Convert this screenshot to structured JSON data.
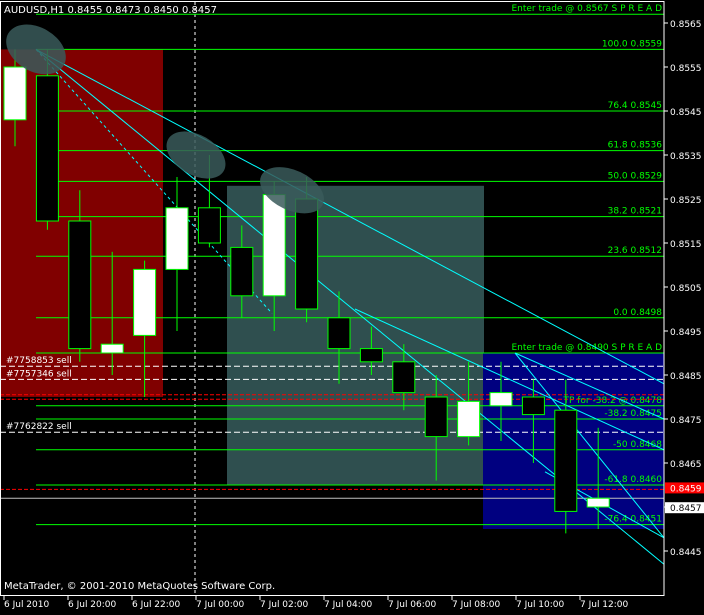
{
  "header": {
    "symbol_text": "AUDUSD,H1  0.8455 0.8473 0.8450 0.8457"
  },
  "footer": {
    "copyright": "MetaTrader, © 2001-2010 MetaQuotes Software Corp."
  },
  "colors": {
    "background": "#000000",
    "bull_candle": "#ffffff",
    "bear_candle": "#000000",
    "candle_outline": "#00ff00",
    "fib_line": "#00ff00",
    "fib_text": "#00ff00",
    "trend_line": "#00ffff",
    "zone_red": "#800000",
    "zone_teal": "#2f4f4f",
    "zone_blue": "#000080",
    "ellipse": "#3a5a5a",
    "current_price_bg": "#ffffff",
    "alert_price_bg": "#ff0000",
    "order_line": "#ffffff",
    "axis_text": "#ffffff"
  },
  "chart_data": {
    "type": "candlestick",
    "timeframe": "H1",
    "y_range": [
      0.844,
      0.857
    ],
    "price_axis_ticks": [
      "0.8565",
      "0.8555",
      "0.8545",
      "0.8535",
      "0.8525",
      "0.8515",
      "0.8505",
      "0.8495",
      "0.8485",
      "0.8475",
      "0.8465",
      "0.8455",
      "0.8445"
    ],
    "time_axis_labels": [
      "6 Jul 2010",
      "6 Jul 20:00",
      "6 Jul 22:00",
      "7 Jul 00:00",
      "7 Jul 02:00",
      "7 Jul 04:00",
      "7 Jul 06:00",
      "7 Jul 08:00",
      "7 Jul 10:00",
      "7 Jul 12:00"
    ],
    "candles": [
      {
        "o": 0.8543,
        "h": 0.8559,
        "l": 0.8537,
        "c": 0.8555
      },
      {
        "o": 0.8553,
        "h": 0.8559,
        "l": 0.8518,
        "c": 0.852
      },
      {
        "o": 0.852,
        "h": 0.8527,
        "l": 0.8488,
        "c": 0.8491
      },
      {
        "o": 0.849,
        "h": 0.8513,
        "l": 0.8485,
        "c": 0.8492
      },
      {
        "o": 0.8494,
        "h": 0.8511,
        "l": 0.848,
        "c": 0.8509
      },
      {
        "o": 0.8509,
        "h": 0.853,
        "l": 0.8495,
        "c": 0.8523
      },
      {
        "o": 0.8523,
        "h": 0.8535,
        "l": 0.8514,
        "c": 0.8515
      },
      {
        "o": 0.8514,
        "h": 0.8519,
        "l": 0.8498,
        "c": 0.8503
      },
      {
        "o": 0.8503,
        "h": 0.8529,
        "l": 0.8495,
        "c": 0.8526
      },
      {
        "o": 0.8525,
        "h": 0.853,
        "l": 0.8497,
        "c": 0.85
      },
      {
        "o": 0.8498,
        "h": 0.8504,
        "l": 0.8483,
        "c": 0.8491
      },
      {
        "o": 0.8491,
        "h": 0.8496,
        "l": 0.8485,
        "c": 0.8488
      },
      {
        "o": 0.8488,
        "h": 0.8492,
        "l": 0.8477,
        "c": 0.8481
      },
      {
        "o": 0.848,
        "h": 0.8485,
        "l": 0.8461,
        "c": 0.8471
      },
      {
        "o": 0.8471,
        "h": 0.8488,
        "l": 0.8469,
        "c": 0.8479
      },
      {
        "o": 0.8478,
        "h": 0.8488,
        "l": 0.847,
        "c": 0.8481
      },
      {
        "o": 0.848,
        "h": 0.8484,
        "l": 0.8465,
        "c": 0.8476
      },
      {
        "o": 0.8477,
        "h": 0.8484,
        "l": 0.8449,
        "c": 0.8454
      },
      {
        "o": 0.8455,
        "h": 0.8473,
        "l": 0.845,
        "c": 0.8457
      }
    ],
    "fib_levels": [
      {
        "label": "Enter trade @  0.8567  S P R E A D",
        "price": 0.8567
      },
      {
        "label": "100.0      0.8559",
        "price": 0.8559
      },
      {
        "label": "76.4      0.8545",
        "price": 0.8545
      },
      {
        "label": "61.8      0.8536",
        "price": 0.8536
      },
      {
        "label": "50.0      0.8529",
        "price": 0.8529
      },
      {
        "label": "38.2      0.8521",
        "price": 0.8521
      },
      {
        "label": "23.6      0.8512",
        "price": 0.8512
      },
      {
        "label": "0.0      0.8498",
        "price": 0.8498
      },
      {
        "label": "Enter trade @  0.8490  S P R E A D",
        "price": 0.849
      },
      {
        "label": "TP for -38.2 @  0.8478",
        "price": 0.8478
      },
      {
        "label": "-38.2      0.8475",
        "price": 0.8475
      },
      {
        "label": "-50      0.8468",
        "price": 0.8468
      },
      {
        "label": "-61.8      0.8460",
        "price": 0.846
      },
      {
        "label": "-76.4      0.8451",
        "price": 0.8451
      }
    ],
    "orders": [
      {
        "label": "#7758853 sell",
        "price": 0.8487
      },
      {
        "label": "#7757346 sell",
        "price": 0.8484
      },
      {
        "label": "#7762822 sell",
        "price": 0.8472
      }
    ],
    "current_price": "0.8457",
    "alert_price": "0.8459"
  }
}
